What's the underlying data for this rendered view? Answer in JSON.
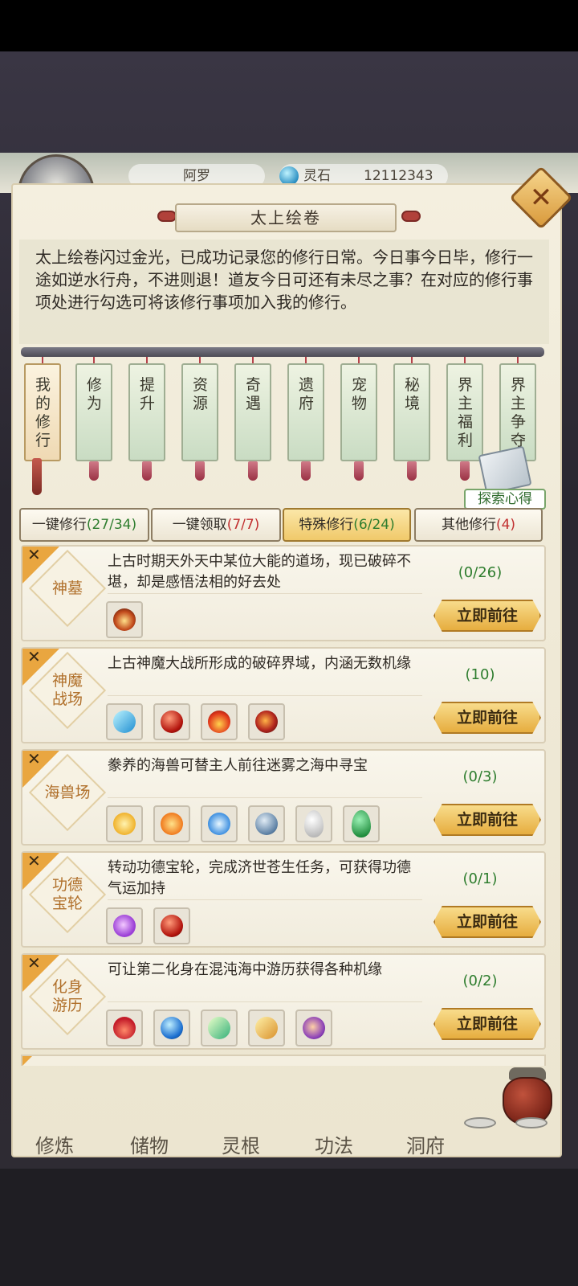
{
  "hud": {
    "player_name": "阿罗",
    "currency_label": "灵石",
    "currency_value": "12112343"
  },
  "panel": {
    "title": "太上绘卷",
    "intro": "太上绘卷闪过金光，已成功记录您的修行日常。今日事今日毕，修行一途如逆水行舟，不进则退！道友今日可还有未尽之事？在对应的修行事项处进行勾选可将该修行事项加入我的修行。"
  },
  "scroll_tabs": [
    {
      "label": "我的修行",
      "active": true
    },
    {
      "label": "修为"
    },
    {
      "label": "提升"
    },
    {
      "label": "资源"
    },
    {
      "label": "奇遇"
    },
    {
      "label": "遗府"
    },
    {
      "label": "宠物"
    },
    {
      "label": "秘境"
    },
    {
      "label": "界主福利"
    },
    {
      "label": "界主争夺"
    }
  ],
  "explore_label": "探索心得",
  "filter_tabs": [
    {
      "label": "一键修行",
      "count": "(27/34)",
      "count_color": "green"
    },
    {
      "label": "一键领取",
      "count": "(7/7)",
      "count_color": "red"
    },
    {
      "label": "特殊修行",
      "count": "(6/24)",
      "count_color": "green",
      "selected": true
    },
    {
      "label": "其他修行",
      "count": "(4)",
      "count_color": "red"
    }
  ],
  "activities": [
    {
      "name": "神墓",
      "desc": "上古时期天外天中某位大能的道场，现已破碎不堪，却是感悟法相的好去处",
      "count": "(0/26)",
      "button": "立即前往",
      "rewards": [
        "shrine-icon"
      ]
    },
    {
      "name": "神魔战场",
      "desc": "上古神魔大战所形成的破碎界域，内涵无数机缘",
      "count": "(10)",
      "button": "立即前往",
      "rewards": [
        "blue-crystal-icon",
        "red-orb-icon",
        "flame-icon",
        "demon-orb-icon"
      ]
    },
    {
      "name": "海兽场",
      "desc": "豢养的海兽可替主人前往迷雾之海中寻宝",
      "count": "(0/3)",
      "button": "立即前往",
      "rewards": [
        "gold-flower-icon",
        "orange-flower-icon",
        "water-crown-icon",
        "blue-pearl-icon",
        "white-egg-icon",
        "green-egg-icon"
      ]
    },
    {
      "name": "功德宝轮",
      "desc": "转动功德宝轮，完成济世苍生任务，可获得功德气运加持",
      "count": "(0/1)",
      "button": "立即前往",
      "rewards": [
        "purple-swirl-icon",
        "red-orb-icon"
      ]
    },
    {
      "name": "化身游历",
      "desc": "可让第二化身在混沌海中游历获得各种机缘",
      "count": "(0/2)",
      "button": "立即前往",
      "rewards": [
        "red-flame-icon",
        "blue-orb-icon",
        "green-crystal-icon",
        "gold-leaf-icon",
        "violet-orb-icon"
      ]
    }
  ],
  "bottom_nav": [
    "修炼",
    "储物",
    "灵根",
    "功法",
    "洞府"
  ],
  "colors": {
    "accent_gold": "#e6ad3f",
    "count_green": "#2e7d2e",
    "count_red": "#c12f2f",
    "diamond_text": "#b0702b"
  }
}
